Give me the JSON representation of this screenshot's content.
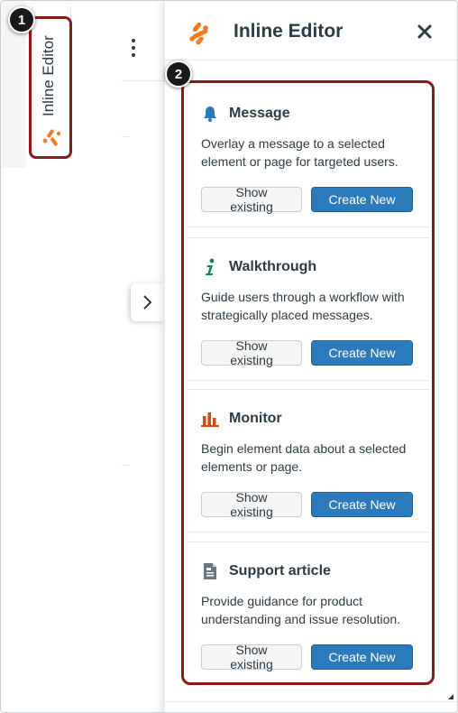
{
  "sidebar_tab": {
    "label": "Inline Editor",
    "logo_icon": "inline-editor-logo-icon"
  },
  "badges": {
    "one": "1",
    "two": "2"
  },
  "panel": {
    "title": "Inline Editor",
    "close_icon": "close-icon",
    "collapse_icon": "chevron-right-icon"
  },
  "cards": [
    {
      "title": "Message",
      "icon": "bell-icon",
      "icon_color": "#2b7abc",
      "description": "Overlay a message to a selected element or page for targeted users.",
      "show_label": "Show existing",
      "create_label": "Create New"
    },
    {
      "title": "Walkthrough",
      "icon": "info-icon",
      "icon_color": "#0b874b",
      "description": "Guide users through a workflow with strategically placed messages.",
      "show_label": "Show existing",
      "create_label": "Create New"
    },
    {
      "title": "Monitor",
      "icon": "bar-chart-icon",
      "icon_color": "#c94e0f",
      "description": "Begin element data about a selected elements or page.",
      "show_label": "Show existing",
      "create_label": "Create New"
    },
    {
      "title": "Support article",
      "icon": "document-icon",
      "icon_color": "#6b7780",
      "description": "Provide guidance for product understanding and issue resolution.",
      "show_label": "Show existing",
      "create_label": "Create New"
    }
  ],
  "colors": {
    "accent": "#2b7abc",
    "highlight": "#8b1a1a",
    "brand_orange": "#f47a20"
  }
}
